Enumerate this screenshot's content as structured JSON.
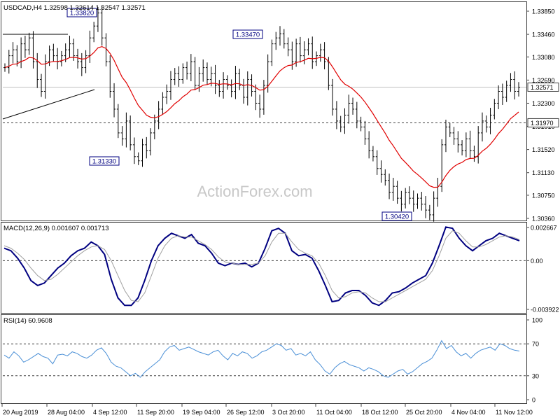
{
  "colors": {
    "bars": "#000000",
    "ma": "#e00000",
    "macd": "#000080",
    "signal": "#a0a0a0",
    "rsi": "#4a8fd6",
    "grid": "#404040",
    "watermark": "#c8c8c8"
  },
  "watermark": "ActionForex.com",
  "chart_data": [
    {
      "type": "candlestick",
      "title": "USDCAD,H4 1.32598 1.32614 1.32547 1.32571",
      "ylim": [
        1.3036,
        1.3385
      ],
      "y_ticks": [
        "1.33850",
        "1.33460",
        "1.33080",
        "1.32690",
        "1.32300",
        "1.31910",
        "1.31520",
        "1.31130",
        "1.30750",
        "1.30360"
      ],
      "current_price": "1.32571",
      "level_line": "1.31970",
      "trendlines": [
        {
          "from": [
            "20 Aug 2019",
            1.3346
          ],
          "to": [
            "28 Aug 2019",
            1.3346
          ]
        },
        {
          "from": [
            "20 Aug 2019",
            1.32
          ],
          "to": [
            "4 Sep 2019",
            1.3257
          ]
        }
      ],
      "annotations": [
        {
          "text": "1.33820",
          "at": "27 Aug 2019"
        },
        {
          "text": "1.31330",
          "at": "10 Sep 2019"
        },
        {
          "text": "1.33470",
          "at": "3 Oct 2019"
        },
        {
          "text": "1.30420",
          "at": "29 Oct 2019"
        }
      ],
      "moving_average": "red",
      "series": [
        {
          "values": [
            1.329,
            1.331,
            1.332,
            1.33,
            1.333,
            1.332,
            1.334,
            1.33,
            1.327,
            1.325,
            1.33,
            1.332,
            1.331,
            1.33,
            1.331,
            1.332,
            1.333,
            1.331,
            1.33,
            1.329,
            1.331,
            1.334,
            1.336,
            1.3382,
            1.334,
            1.33,
            1.325,
            1.322,
            1.318,
            1.317,
            1.32,
            1.316,
            1.314,
            1.3133,
            1.316,
            1.315,
            1.318,
            1.32,
            1.322,
            1.324,
            1.325,
            1.327,
            1.328,
            1.327,
            1.329,
            1.328,
            1.33,
            1.326,
            1.328,
            1.329,
            1.327,
            1.328,
            1.326,
            1.325,
            1.327,
            1.326,
            1.325,
            1.328,
            1.326,
            1.324,
            1.327,
            1.325,
            1.323,
            1.322,
            1.326,
            1.33,
            1.333,
            1.334,
            1.3347,
            1.333,
            1.332,
            1.33,
            1.333,
            1.331,
            1.332,
            1.333,
            1.33,
            1.331,
            1.332,
            1.33,
            1.326,
            1.322,
            1.32,
            1.319,
            1.321,
            1.323,
            1.322,
            1.32,
            1.319,
            1.317,
            1.315,
            1.314,
            1.312,
            1.311,
            1.31,
            1.308,
            1.309,
            1.307,
            1.306,
            1.308,
            1.307,
            1.306,
            1.307,
            1.306,
            1.305,
            1.3042,
            1.307,
            1.309,
            1.316,
            1.319,
            1.318,
            1.317,
            1.316,
            1.315,
            1.317,
            1.315,
            1.314,
            1.318,
            1.32,
            1.319,
            1.321,
            1.323,
            1.325,
            1.324,
            1.326,
            1.327,
            1.325,
            1.3257
          ]
        }
      ]
    },
    {
      "type": "line",
      "title": "MACD(12,26,9) 0.001607 0.001713",
      "ylim": [
        -0.003922,
        0.002667
      ],
      "y_ticks": [
        "0.002667",
        "0.00",
        "-0.003922"
      ],
      "series": [
        {
          "name": "MACD",
          "values": [
            0.001,
            0.0008,
            0.0002,
            -0.0006,
            -0.0016,
            -0.002,
            -0.0018,
            -0.0012,
            -0.0006,
            -0.0002,
            0.0004,
            0.0008,
            0.001,
            0.0015,
            0.0012,
            0.0005,
            -0.0015,
            -0.003,
            -0.0036,
            -0.0036,
            -0.003,
            -0.0016,
            0.0,
            0.0012,
            0.0018,
            0.0022,
            0.002,
            0.0018,
            0.0021,
            0.0014,
            0.0012,
            0.0006,
            -0.0002,
            -0.0004,
            -0.0002,
            -0.0003,
            -0.0002,
            -0.0005,
            -0.0002,
            0.001,
            0.0024,
            0.0026,
            0.0022,
            0.0008,
            0.0004,
            0.0005,
            0.0002,
            -0.0008,
            -0.002,
            -0.0033,
            -0.0032,
            -0.0026,
            -0.0024,
            -0.0024,
            -0.0028,
            -0.0034,
            -0.0036,
            -0.0032,
            -0.0026,
            -0.0025,
            -0.0022,
            -0.0018,
            -0.0015,
            -0.0012,
            -0.0002,
            0.0012,
            0.0027,
            0.0026,
            0.0018,
            0.0012,
            0.0008,
            0.0012,
            0.0016,
            0.0018,
            0.0022,
            0.002,
            0.0018,
            0.0016
          ]
        },
        {
          "name": "Signal",
          "values": [
            0.0012,
            0.001,
            0.0006,
            0.0001,
            -0.0006,
            -0.0012,
            -0.0016,
            -0.0015,
            -0.0011,
            -0.0006,
            -0.0001,
            0.0004,
            0.0008,
            0.0011,
            0.0012,
            0.0009,
            0.0,
            -0.0012,
            -0.0024,
            -0.0032,
            -0.0033,
            -0.0026,
            -0.0012,
            0.0002,
            0.0012,
            0.0018,
            0.002,
            0.0019,
            0.0019,
            0.0016,
            0.0013,
            0.0009,
            0.0003,
            -0.0001,
            -0.0002,
            -0.0003,
            -0.0003,
            -0.0003,
            -0.0002,
            0.0004,
            0.0015,
            0.0022,
            0.0022,
            0.0015,
            0.0009,
            0.0006,
            0.0004,
            -0.0002,
            -0.0012,
            -0.0024,
            -0.003,
            -0.0029,
            -0.0026,
            -0.0025,
            -0.0026,
            -0.003,
            -0.0033,
            -0.0033,
            -0.003,
            -0.0027,
            -0.0024,
            -0.0021,
            -0.0018,
            -0.0015,
            -0.0008,
            0.0004,
            0.0018,
            0.0024,
            0.0022,
            0.0016,
            0.0011,
            0.0011,
            0.0013,
            0.0016,
            0.0019,
            0.002,
            0.0019,
            0.0017
          ]
        }
      ]
    },
    {
      "type": "line",
      "title": "RSI(14) 60.9608",
      "ylim": [
        0,
        100
      ],
      "y_ticks": [
        "100",
        "70",
        "30",
        "0"
      ],
      "series": [
        {
          "values": [
            56,
            52,
            60,
            55,
            47,
            50,
            54,
            58,
            54,
            52,
            45,
            56,
            57,
            55,
            60,
            58,
            54,
            52,
            56,
            62,
            65,
            58,
            47,
            42,
            40,
            35,
            30,
            33,
            28,
            35,
            40,
            45,
            50,
            60,
            66,
            68,
            62,
            64,
            66,
            63,
            60,
            58,
            56,
            60,
            62,
            55,
            50,
            58,
            55,
            60,
            58,
            52,
            55,
            60,
            62,
            66,
            70,
            68,
            62,
            64,
            56,
            58,
            55,
            60,
            50,
            44,
            36,
            32,
            40,
            45,
            48,
            44,
            42,
            40,
            36,
            40,
            38,
            35,
            30,
            28,
            32,
            36,
            38,
            32,
            35,
            40,
            45,
            48,
            52,
            62,
            74,
            64,
            68,
            60,
            55,
            58,
            52,
            58,
            62,
            64,
            66,
            62,
            70,
            68,
            64,
            62,
            61
          ]
        }
      ]
    }
  ],
  "x_ticks": [
    "20 Aug 2019",
    "28 Aug 04:00",
    "4 Sep 12:00",
    "11 Sep 20:00",
    "19 Sep 04:00",
    "26 Sep 12:00",
    "3 Oct 20:00",
    "11 Oct 04:00",
    "18 Oct 12:00",
    "25 Oct 20:00",
    "4 Nov 04:00",
    "11 Nov 12:00"
  ]
}
